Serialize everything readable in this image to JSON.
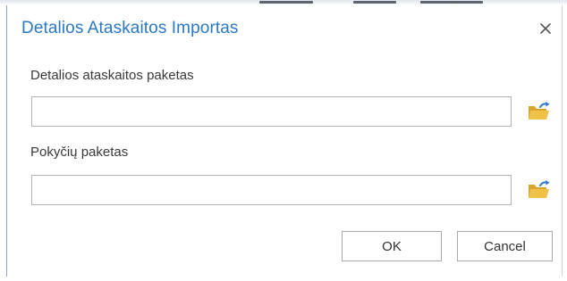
{
  "dialog": {
    "title": "Detalios Ataskaitos Importas",
    "close_icon": "close-icon",
    "fields": [
      {
        "label": "Detalios ataskaitos paketas",
        "value": "",
        "browse_icon": "folder-open-icon"
      },
      {
        "label": "Pokyčių paketas",
        "value": "",
        "browse_icon": "folder-open-icon"
      }
    ],
    "buttons": {
      "ok_label": "OK",
      "cancel_label": "Cancel"
    }
  },
  "colors": {
    "title": "#2b78c5",
    "folder_body": "#e8b73a",
    "folder_arrow": "#2b78c5",
    "input_border": "#b3b3b3"
  }
}
